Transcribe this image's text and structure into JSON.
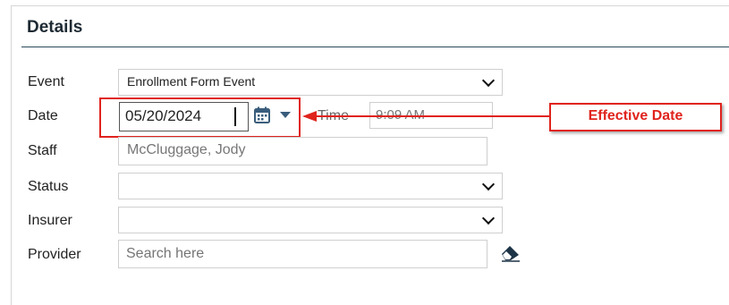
{
  "section": {
    "title": "Details"
  },
  "fields": {
    "event": {
      "label": "Event",
      "value": "Enrollment Form Event"
    },
    "date": {
      "label": "Date",
      "value": "05/20/2024"
    },
    "time": {
      "label": "Time",
      "value": "9:09 AM"
    },
    "staff": {
      "label": "Staff",
      "value": "McCluggage, Jody"
    },
    "status": {
      "label": "Status",
      "value": ""
    },
    "insurer": {
      "label": "Insurer",
      "value": ""
    },
    "provider": {
      "label": "Provider",
      "placeholder": "Search here"
    }
  },
  "annotation": {
    "text": "Effective Date",
    "color": "#e0231d"
  },
  "icons": [
    "calendar-icon",
    "dropdown-caret-icon",
    "chevron-down-icon",
    "eraser-icon"
  ]
}
